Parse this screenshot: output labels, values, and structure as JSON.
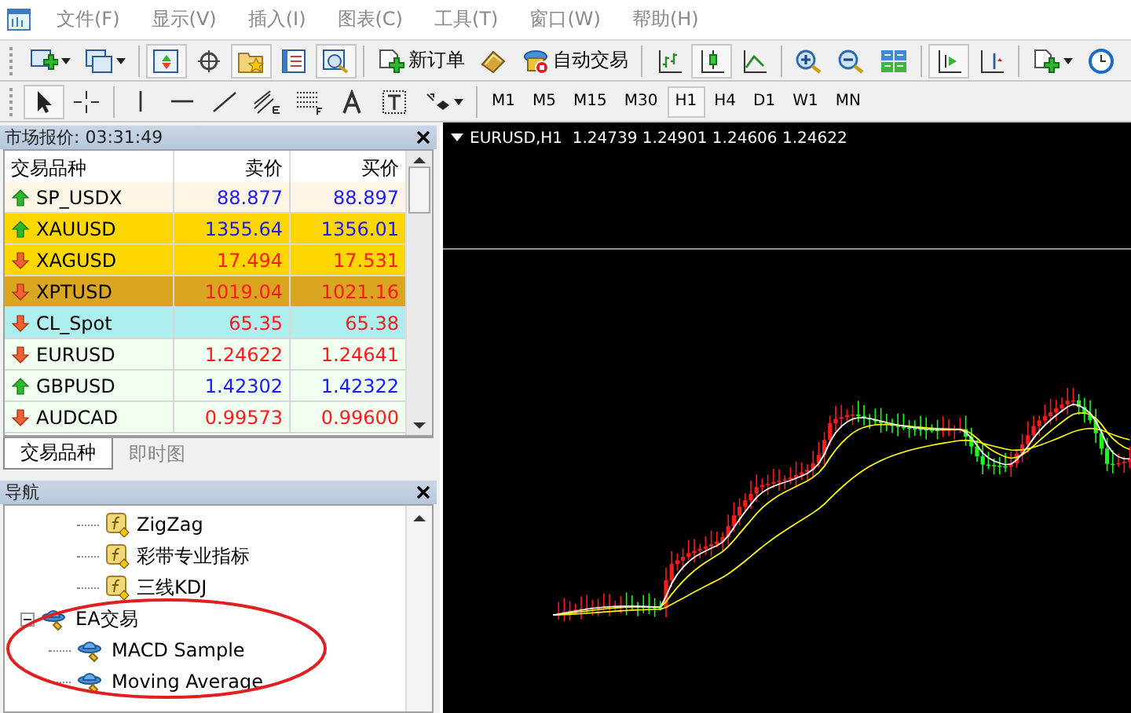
{
  "menu": [
    "文件(F)",
    "显示(V)",
    "插入(I)",
    "图表(C)",
    "工具(T)",
    "窗口(W)",
    "帮助(H)"
  ],
  "toolbar_main": [
    {
      "kind": "new-chart",
      "pressed": false,
      "dropdown": true
    },
    {
      "kind": "profiles",
      "pressed": false,
      "dropdown": true
    },
    {
      "kind": "sep"
    },
    {
      "kind": "market-watch",
      "pressed": true
    },
    {
      "kind": "crosshair",
      "pressed": false
    },
    {
      "kind": "navigator",
      "pressed": true
    },
    {
      "kind": "terminal",
      "pressed": false
    },
    {
      "kind": "tester",
      "pressed": true
    },
    {
      "kind": "sep"
    },
    {
      "kind": "new-order",
      "pressed": false,
      "label": "新订单"
    },
    {
      "kind": "editor",
      "pressed": false
    },
    {
      "kind": "auto-trading",
      "pressed": false,
      "label": "自动交易"
    },
    {
      "kind": "sep"
    },
    {
      "kind": "bar-chart",
      "pressed": false
    },
    {
      "kind": "candle-chart",
      "pressed": true
    },
    {
      "kind": "line-chart",
      "pressed": false
    },
    {
      "kind": "sep"
    },
    {
      "kind": "zoom-in",
      "pressed": false
    },
    {
      "kind": "zoom-out",
      "pressed": false
    },
    {
      "kind": "tile",
      "pressed": false
    },
    {
      "kind": "sep"
    },
    {
      "kind": "auto-scroll",
      "pressed": true
    },
    {
      "kind": "chart-shift",
      "pressed": false
    },
    {
      "kind": "sep"
    },
    {
      "kind": "template",
      "pressed": false,
      "dropdown": true
    },
    {
      "kind": "clock",
      "pressed": false
    }
  ],
  "toolbar_draw": [
    {
      "kind": "cursor",
      "pressed": true
    },
    {
      "kind": "crosshair-line",
      "pressed": false
    },
    {
      "kind": "sep"
    },
    {
      "kind": "vline",
      "pressed": false
    },
    {
      "kind": "hline",
      "pressed": false
    },
    {
      "kind": "trendline",
      "pressed": false
    },
    {
      "kind": "channel",
      "pressed": false
    },
    {
      "kind": "fibo",
      "pressed": false
    },
    {
      "kind": "text",
      "pressed": false
    },
    {
      "kind": "label",
      "pressed": false
    },
    {
      "kind": "arrows",
      "pressed": false,
      "dropdown": true
    }
  ],
  "timeframes": [
    {
      "label": "M1",
      "selected": false
    },
    {
      "label": "M5",
      "selected": false
    },
    {
      "label": "M15",
      "selected": false
    },
    {
      "label": "M30",
      "selected": false
    },
    {
      "label": "H1",
      "selected": true
    },
    {
      "label": "H4",
      "selected": false
    },
    {
      "label": "D1",
      "selected": false
    },
    {
      "label": "W1",
      "selected": false
    },
    {
      "label": "MN",
      "selected": false
    }
  ],
  "market_watch": {
    "title": "市场报价: 03:31:49",
    "columns": [
      "交易品种",
      "卖价",
      "买价"
    ],
    "rows": [
      {
        "symbol": "SP_USDX",
        "bid": "88.877",
        "ask": "88.897",
        "rising": true,
        "color": "#fdf5e6"
      },
      {
        "symbol": "XAUUSD",
        "bid": "1355.64",
        "ask": "1356.01",
        "rising": true,
        "color": "#ffd700"
      },
      {
        "symbol": "XAGUSD",
        "bid": "17.494",
        "ask": "17.531",
        "rising": false,
        "color": "#ffd700"
      },
      {
        "symbol": "XPTUSD",
        "bid": "1019.04",
        "ask": "1021.16",
        "rising": false,
        "color": "#daa520"
      },
      {
        "symbol": "CL_Spot",
        "bid": "65.35",
        "ask": "65.38",
        "rising": false,
        "color": "#afeeee"
      },
      {
        "symbol": "EURUSD",
        "bid": "1.24622",
        "ask": "1.24641",
        "rising": false,
        "color": "#f0fff0"
      },
      {
        "symbol": "GBPUSD",
        "bid": "1.42302",
        "ask": "1.42322",
        "rising": true,
        "color": "#f0fff0"
      },
      {
        "symbol": "AUDCAD",
        "bid": "0.99573",
        "ask": "0.99600",
        "rising": false,
        "color": "#f0fff0"
      }
    ],
    "tabs": [
      {
        "label": "交易品种",
        "selected": true
      },
      {
        "label": "即时图",
        "selected": false
      }
    ]
  },
  "navigator": {
    "title": "导航",
    "tree": [
      {
        "children": [
          {
            "label": "ZigZag",
            "kind": "indicator"
          },
          {
            "label": "彩带专业指标",
            "kind": "indicator"
          },
          {
            "label": "三线KDJ",
            "kind": "indicator"
          }
        ]
      },
      {
        "label": "EA交易",
        "kind": "experts",
        "expanded": true,
        "children": [
          {
            "label": "MACD Sample",
            "kind": "expert"
          },
          {
            "label": "Moving Average",
            "kind": "expert"
          }
        ]
      }
    ]
  },
  "chart": {
    "title": "EURUSD,H1  1.24739 1.24901 1.24606 1.24622"
  }
}
